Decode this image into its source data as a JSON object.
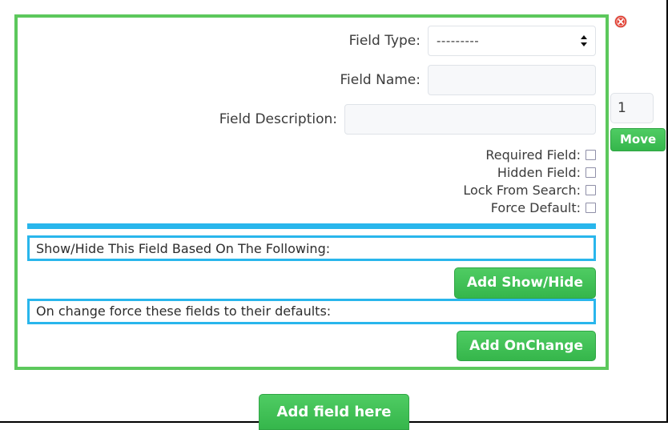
{
  "panel": {
    "field_type": {
      "label": "Field Type:",
      "selected": "---------",
      "icon": "updown-arrows-icon"
    },
    "field_name": {
      "label": "Field Name:",
      "value": "",
      "placeholder": ""
    },
    "field_description": {
      "label": "Field Description:",
      "value": "",
      "placeholder": ""
    },
    "checkboxes": [
      {
        "label": "Required Field:",
        "checked": false,
        "name": "required-field"
      },
      {
        "label": "Hidden Field:",
        "checked": false,
        "name": "hidden-field"
      },
      {
        "label": "Lock From Search:",
        "checked": false,
        "name": "lock-from-search"
      },
      {
        "label": "Force Default:",
        "checked": false,
        "name": "force-default"
      }
    ],
    "show_hide": {
      "heading": "Show/Hide This Field Based On The Following:",
      "button": "Add Show/Hide"
    },
    "on_change": {
      "heading": "On change force these fields to their defaults:",
      "button": "Add OnChange"
    }
  },
  "right_rail": {
    "close_icon": "close-circle-icon",
    "position_value": "1",
    "move_button": "Move"
  },
  "footer": {
    "add_field_button": "Add field here"
  },
  "colors": {
    "panel_border_green": "#5cc85c",
    "accent_blue": "#29b6ec",
    "button_green": "#40c057",
    "close_red": "#e13b2e",
    "input_bg": "#f7f8fa"
  }
}
